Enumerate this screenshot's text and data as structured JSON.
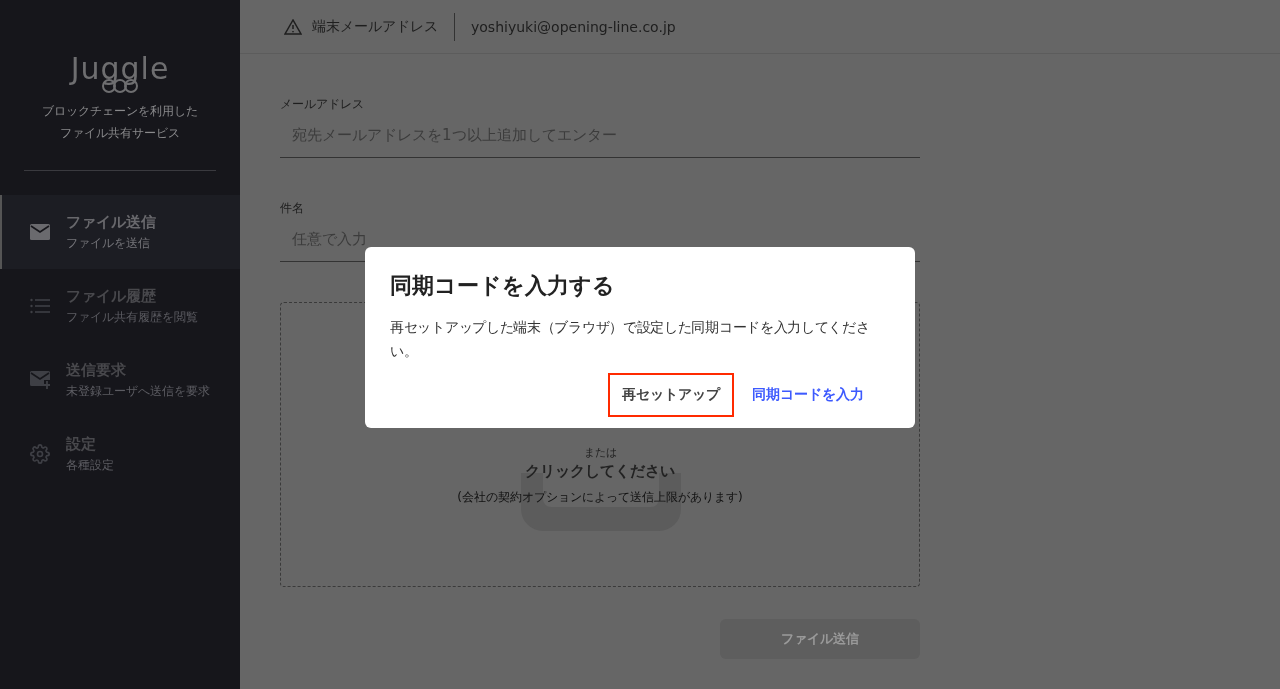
{
  "sidebar": {
    "logo": "Juggle",
    "tagline": [
      "ブロックチェーンを利用した",
      "ファイル共有サービス"
    ],
    "items": [
      {
        "kind": "send",
        "title": "ファイル送信",
        "subtitle": "ファイルを送信",
        "selected": true
      },
      {
        "kind": "history",
        "title": "ファイル履歴",
        "subtitle": "ファイル共有履歴を閲覧",
        "selected": false
      },
      {
        "kind": "request",
        "title": "送信要求",
        "subtitle": "未登録ユーザへ送信を要求",
        "selected": false
      },
      {
        "kind": "settings",
        "title": "設定",
        "subtitle": "各種設定",
        "selected": false
      }
    ]
  },
  "header": {
    "label": "端末メールアドレス",
    "email": "yoshiyuki@opening-line.co.jp"
  },
  "form": {
    "fields": [
      {
        "label": "メールアドレス",
        "placeholder": "宛先メールアドレスを1つ以上追加してエンター"
      },
      {
        "label": "件名",
        "placeholder": "任意で入力"
      }
    ],
    "dropzone": {
      "or": "または",
      "click": "クリックしてください",
      "note": "(会社の契約オプションによって送信上限があります)"
    },
    "submit": {
      "label": "ファイル送信",
      "disabled": true
    }
  },
  "dialog": {
    "title": "同期コードを入力する",
    "message": "再セットアップした端末（ブラウザ）で設定した同期コードを入力してください。",
    "buttons": [
      {
        "label": "再セットアップ",
        "kind": "secondary",
        "focused": true
      },
      {
        "label": "同期コードを入力",
        "kind": "primary",
        "focused": false
      }
    ]
  }
}
